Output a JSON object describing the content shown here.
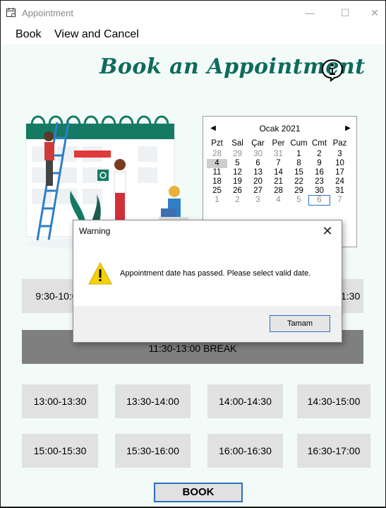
{
  "window": {
    "title": "Appointment"
  },
  "menu": {
    "items": [
      "Book",
      "View and Cancel"
    ]
  },
  "heading": "Book an Appointment",
  "calendar": {
    "month": "Ocak 2021",
    "weekdays": [
      "Pzt",
      "Sal",
      "Çar",
      "Per",
      "Cum",
      "Cmt",
      "Paz"
    ],
    "weeks": [
      [
        "28",
        "29",
        "30",
        "31",
        "1",
        "2",
        "3"
      ],
      [
        "4",
        "5",
        "6",
        "7",
        "8",
        "9",
        "10"
      ],
      [
        "11",
        "12",
        "13",
        "14",
        "15",
        "16",
        "17"
      ],
      [
        "18",
        "19",
        "20",
        "21",
        "22",
        "23",
        "24"
      ],
      [
        "25",
        "26",
        "27",
        "28",
        "29",
        "30",
        "31"
      ],
      [
        "1",
        "2",
        "3",
        "4",
        "5",
        "6",
        "7"
      ]
    ],
    "selected_day": "4",
    "today_day": "6"
  },
  "slots": {
    "row1_left": "9:30-10:0",
    "row1_right": "1:30",
    "break_label": "11:30-13:00 BREAK",
    "row3": [
      "13:00-13:30",
      "13:30-14:00",
      "14:00-14:30",
      "14:30-15:00"
    ],
    "row4": [
      "15:00-15:30",
      "15:30-16:00",
      "16:00-16:30",
      "16:30-17:00"
    ]
  },
  "book_button": "BOOK",
  "dialog": {
    "title": "Warning",
    "message": "Appointment date has passed. Please select valid date.",
    "ok_label": "Tamam"
  },
  "colors": {
    "heading": "#0f6b5c",
    "background": "#f3fbf8",
    "accent": "#2f6fbf",
    "break_bar": "#7f7f7f"
  }
}
